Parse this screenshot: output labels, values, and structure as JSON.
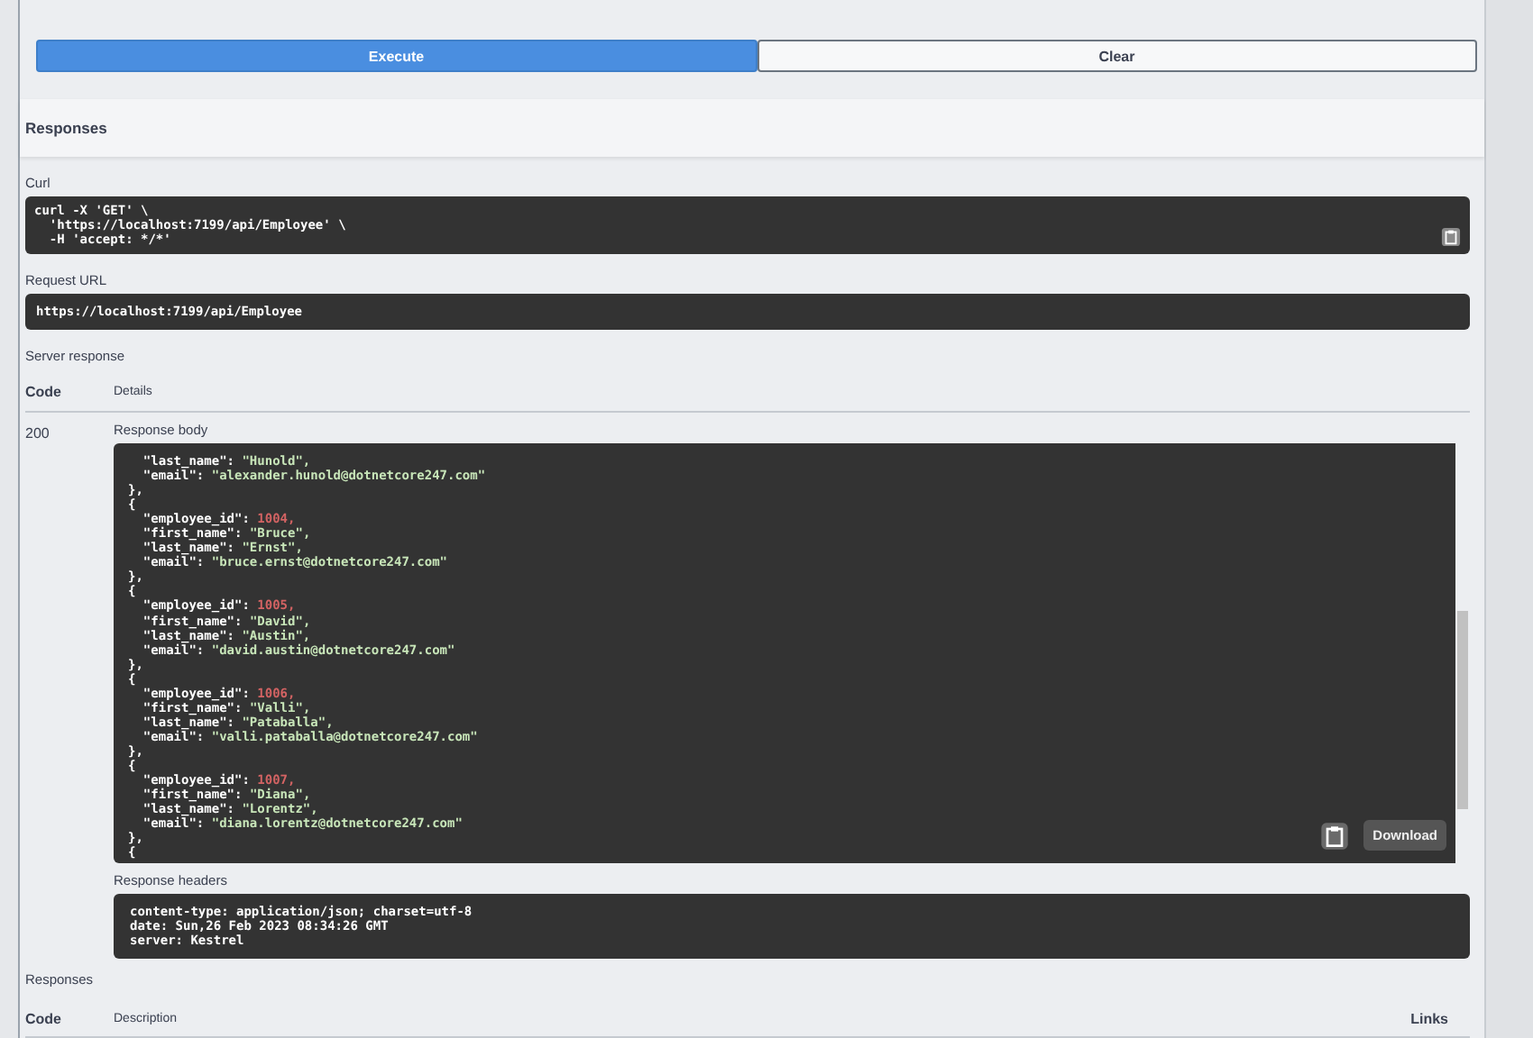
{
  "actions": {
    "execute": "Execute",
    "clear": "Clear"
  },
  "responses_heading": "Responses",
  "curl": {
    "label": "Curl",
    "lines": [
      "curl -X 'GET' \\",
      "  'https://localhost:7199/api/Employee' \\",
      "  -H 'accept: */*'"
    ]
  },
  "request_url": {
    "label": "Request URL",
    "value": "https://localhost:7199/api/Employee"
  },
  "server_response": {
    "label": "Server response",
    "columns": [
      "Code",
      "Details"
    ],
    "code": "200",
    "body": {
      "label": "Response body",
      "download": "Download",
      "lines": [
        {
          "kind": "string",
          "key": "  \"last_name\": ",
          "value": "\"Hunold\","
        },
        {
          "kind": "string",
          "key": "  \"email\": ",
          "value": "\"alexander.hunold@dotnetcore247.com\""
        },
        {
          "kind": "punct",
          "text": "},"
        },
        {
          "kind": "punct",
          "text": "{"
        },
        {
          "kind": "number",
          "key": "  \"employee_id\": ",
          "value": "1004,"
        },
        {
          "kind": "string",
          "key": "  \"first_name\": ",
          "value": "\"Bruce\","
        },
        {
          "kind": "string",
          "key": "  \"last_name\": ",
          "value": "\"Ernst\","
        },
        {
          "kind": "string",
          "key": "  \"email\": ",
          "value": "\"bruce.ernst@dotnetcore247.com\""
        },
        {
          "kind": "punct",
          "text": "},"
        },
        {
          "kind": "punct",
          "text": "{"
        },
        {
          "kind": "number",
          "key": "  \"employee_id\": ",
          "value": "1005,"
        },
        {
          "kind": "string",
          "key": "  \"first_name\": ",
          "value": "\"David\","
        },
        {
          "kind": "string",
          "key": "  \"last_name\": ",
          "value": "\"Austin\","
        },
        {
          "kind": "string",
          "key": "  \"email\": ",
          "value": "\"david.austin@dotnetcore247.com\""
        },
        {
          "kind": "punct",
          "text": "},"
        },
        {
          "kind": "punct",
          "text": "{"
        },
        {
          "kind": "number",
          "key": "  \"employee_id\": ",
          "value": "1006,"
        },
        {
          "kind": "string",
          "key": "  \"first_name\": ",
          "value": "\"Valli\","
        },
        {
          "kind": "string",
          "key": "  \"last_name\": ",
          "value": "\"Pataballa\","
        },
        {
          "kind": "string",
          "key": "  \"email\": ",
          "value": "\"valli.pataballa@dotnetcore247.com\""
        },
        {
          "kind": "punct",
          "text": "},"
        },
        {
          "kind": "punct",
          "text": "{"
        },
        {
          "kind": "number",
          "key": "  \"employee_id\": ",
          "value": "1007,"
        },
        {
          "kind": "string",
          "key": "  \"first_name\": ",
          "value": "\"Diana\","
        },
        {
          "kind": "string",
          "key": "  \"last_name\": ",
          "value": "\"Lorentz\","
        },
        {
          "kind": "string",
          "key": "  \"email\": ",
          "value": "\"diana.lorentz@dotnetcore247.com\""
        },
        {
          "kind": "punct",
          "text": "},"
        },
        {
          "kind": "punct",
          "text": "{"
        }
      ]
    },
    "headers": {
      "label": "Response headers",
      "lines": [
        "content-type: application/json; charset=utf-8",
        "date: Sun,26 Feb 2023 08:34:26 GMT",
        "server: Kestrel"
      ]
    }
  },
  "responses": {
    "label": "Responses",
    "columns": [
      "Code",
      "Description",
      "Links"
    ]
  }
}
